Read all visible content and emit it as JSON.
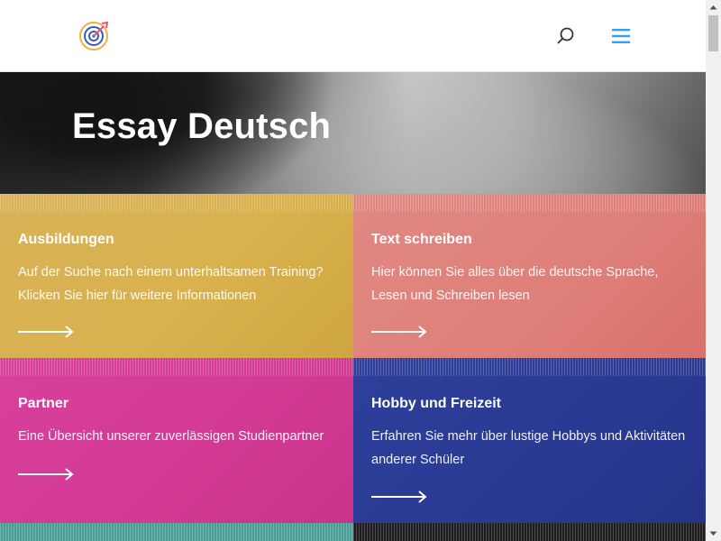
{
  "header": {
    "logo_icon": "target-arrow-logo",
    "search_icon": "search-icon",
    "menu_icon": "hamburger-menu-icon",
    "accent_color": "#2ea3f2"
  },
  "hero": {
    "title": "Essay Deutsch"
  },
  "cards": [
    {
      "title": "Ausbildungen",
      "text": "Auf der Suche nach einem unterhaltsamen Training? Klicken Sie hier für weitere Informationen",
      "color": "#d9b24e"
    },
    {
      "title": "Text schreiben",
      "text": "Hier können Sie alles über die deutsche Sprache, Lesen und Schreiben lesen",
      "color": "#df7f79"
    },
    {
      "title": "Partner",
      "text": "Eine Übersicht unserer zuverlässigen Studienpartner",
      "color": "#d23a95"
    },
    {
      "title": "Hobby und Freizeit",
      "text": "Erfahren Sie mehr über lustige Hobbys und Aktivitäten anderer Schüler",
      "color": "#2a3a93"
    }
  ]
}
